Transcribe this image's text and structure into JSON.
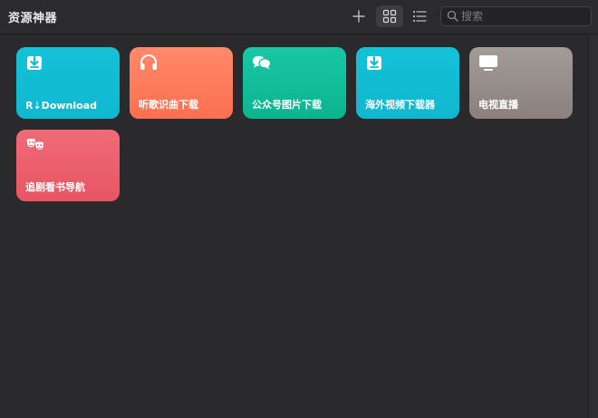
{
  "window": {
    "title": "资源神器"
  },
  "toolbar": {
    "add_icon": "plus-icon",
    "grid_icon": "grid-view-icon",
    "list_icon": "list-view-icon",
    "search_placeholder": "搜索",
    "search_value": ""
  },
  "shortcuts": [
    {
      "label": "R⇣Download",
      "icon": "download-box-icon",
      "gradient": [
        "#14c2d8",
        "#10b7cf"
      ]
    },
    {
      "label": "听歌识曲下载",
      "icon": "headphones-icon",
      "gradient": [
        "#ff8a6a",
        "#fb6f4f"
      ]
    },
    {
      "label": "公众号图片下载",
      "icon": "chat-bubbles-icon",
      "gradient": [
        "#19c7a6",
        "#0cb48f"
      ]
    },
    {
      "label": "海外视频下载器",
      "icon": "download-box-icon",
      "gradient": [
        "#14c2d8",
        "#10b7cf"
      ]
    },
    {
      "label": "电视直播",
      "icon": "tv-icon",
      "gradient": [
        "#a39b97",
        "#8a817d"
      ]
    },
    {
      "label": "追剧看书导航",
      "icon": "theater-masks-icon",
      "gradient": [
        "#f06b78",
        "#e85564"
      ]
    }
  ]
}
